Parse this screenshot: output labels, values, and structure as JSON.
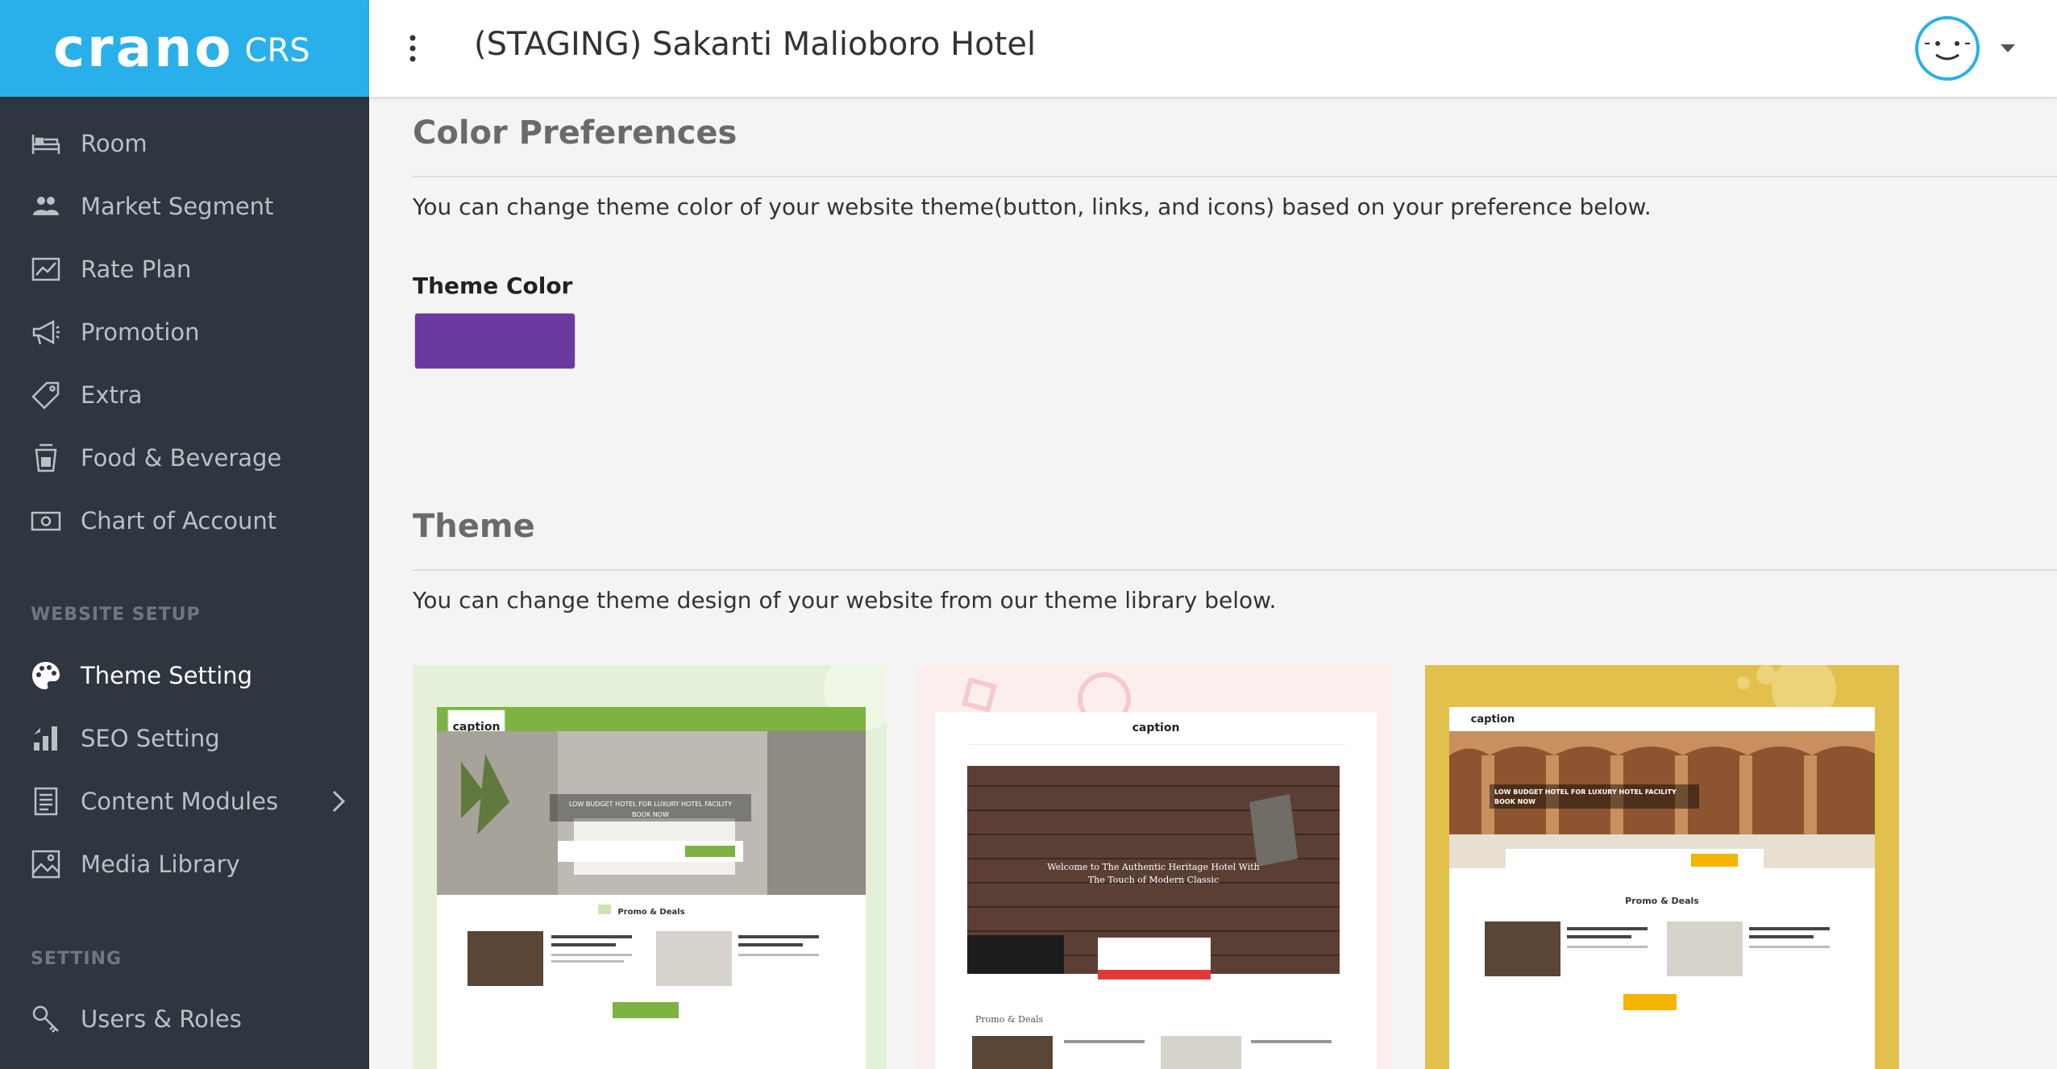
{
  "brand": {
    "logo": "crano",
    "sub": "CRS"
  },
  "header": {
    "title": "(STAGING) Sakanti Malioboro Hotel"
  },
  "sidebar": {
    "items": [
      {
        "label": "Room",
        "icon": "bed-icon"
      },
      {
        "label": "Market Segment",
        "icon": "people-icon"
      },
      {
        "label": "Rate Plan",
        "icon": "chart-icon"
      },
      {
        "label": "Promotion",
        "icon": "megaphone-icon"
      },
      {
        "label": "Extra",
        "icon": "tag-icon"
      },
      {
        "label": "Food & Beverage",
        "icon": "cup-icon"
      },
      {
        "label": "Chart of Account",
        "icon": "money-icon"
      }
    ],
    "website_setup_label": "WEBSITE SETUP",
    "website_items": [
      {
        "label": "Theme Setting",
        "icon": "palette-icon",
        "active": true
      },
      {
        "label": "SEO Setting",
        "icon": "bar-chart-icon"
      },
      {
        "label": "Content Modules",
        "icon": "document-icon"
      },
      {
        "label": "Media Library",
        "icon": "image-icon"
      }
    ],
    "setting_label": "SETTING",
    "setting_items": [
      {
        "label": "Users & Roles",
        "icon": "key-icon"
      }
    ]
  },
  "color_prefs": {
    "title": "Color Preferences",
    "description": "You can change theme color of your website theme(button, links, and icons) based on your preference below.",
    "theme_color_label": "Theme Color",
    "theme_color": "#6a3aa0"
  },
  "theme": {
    "title": "Theme",
    "description": "You can change theme design of your website from our theme library below.",
    "cards": [
      {
        "logo": "caption",
        "hero_text": "LOW BUDGET HOTEL FOR LUXURY HOTEL FACILITY",
        "hero_sub": "BOOK NOW",
        "promo_title": "Promo & Deals",
        "accent": "#7cb342"
      },
      {
        "logo": "caption",
        "hero_text": "Welcome to The Authentic Heritage Hotel With",
        "hero_sub": "The Touch of Modern Classic",
        "promo_title": "Promo & Deals",
        "accent": "#e53935"
      },
      {
        "logo": "caption",
        "hero_text": "LOW BUDGET HOTEL FOR LUXURY HOTEL FACILITY",
        "hero_sub": "BOOK NOW",
        "promo_title": "Promo & Deals",
        "accent": "#f4b400"
      }
    ]
  },
  "colors": {
    "brand_blue": "#29b0ea",
    "sidebar_bg": "#2e3640"
  }
}
